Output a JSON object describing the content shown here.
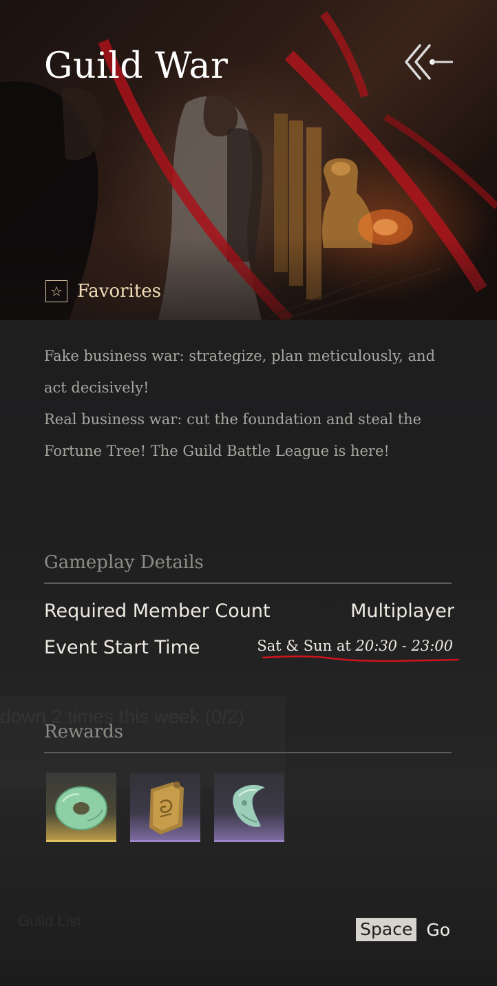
{
  "header": {
    "title": "Guild War",
    "favorites_label": "Favorites",
    "back_icon": "double-chevron-left-icon",
    "star_icon": "star-icon",
    "star_glyph": "☆"
  },
  "description": {
    "line1": "Fake business war: strategize, plan meticulously, and act decisively!",
    "line2": "Real business war: cut the foundation and steal the Fortune Tree! The Guild Battle League is here!"
  },
  "gameplay": {
    "section_title": "Gameplay Details",
    "rows": [
      {
        "label": "Required Member Count",
        "value": "Multiplayer"
      },
      {
        "label": "Event Start Time",
        "value_prefix": "Sat & Sun at",
        "value_time": "20:30 - 23:00"
      }
    ]
  },
  "rewards": {
    "section_title": "Rewards",
    "items": [
      {
        "icon": "jade-disc-icon",
        "rarity_color": "#e1c060"
      },
      {
        "icon": "golden-token-icon",
        "rarity_color": "#9c86c8"
      },
      {
        "icon": "jade-pendant-icon",
        "rarity_color": "#9c86c8"
      }
    ]
  },
  "footer": {
    "key": "Space",
    "action": "Go"
  },
  "background_ghost": {
    "text1": "down 2 times this week (0/2)",
    "text2": "Guild List"
  },
  "colors": {
    "accent_red_underline": "#d0141b",
    "panel_bg": "#1c1c1d"
  }
}
